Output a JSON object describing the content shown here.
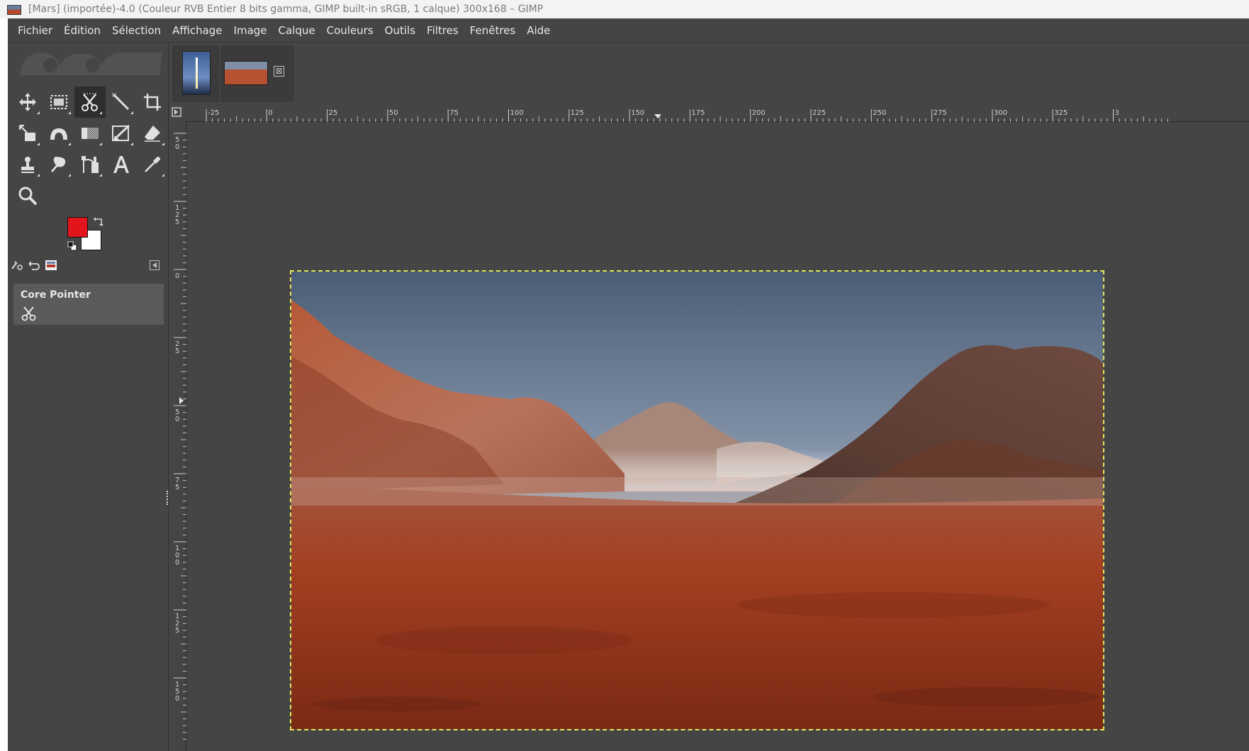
{
  "window": {
    "title": "[Mars] (importée)-4.0 (Couleur RVB Entier 8 bits gamma, GIMP built-in sRGB, 1 calque) 300x168 – GIMP"
  },
  "menubar": {
    "items": [
      "Fichier",
      "Édition",
      "Sélection",
      "Affichage",
      "Image",
      "Calque",
      "Couleurs",
      "Outils",
      "Filtres",
      "Fenêtres",
      "Aide"
    ]
  },
  "toolbox": {
    "tools": [
      {
        "name": "move-tool-icon",
        "active": false
      },
      {
        "name": "rect-select-tool-icon",
        "active": false
      },
      {
        "name": "scissors-select-tool-icon",
        "active": true
      },
      {
        "name": "fuzzy-select-tool-icon",
        "active": false
      },
      {
        "name": "crop-tool-icon",
        "active": false
      },
      {
        "name": "transform-tool-icon",
        "active": false
      },
      {
        "name": "warp-tool-icon",
        "active": false
      },
      {
        "name": "gradient-tool-icon",
        "active": false
      },
      {
        "name": "paint-tool-icon",
        "active": false
      },
      {
        "name": "eraser-tool-icon",
        "active": false
      },
      {
        "name": "clone-tool-icon",
        "active": false
      },
      {
        "name": "smudge-tool-icon",
        "active": false
      },
      {
        "name": "paths-tool-icon",
        "active": false
      },
      {
        "name": "text-tool-icon",
        "active": false
      },
      {
        "name": "color-picker-tool-icon",
        "active": false
      },
      {
        "name": "zoom-tool-icon",
        "active": false
      }
    ],
    "foreground_color": "#e3141b",
    "background_color": "#ffffff"
  },
  "device_status": {
    "title": "Core Pointer"
  },
  "image_tabs": {
    "close_glyph": "⊠"
  },
  "rulers": {
    "horizontal_labels": [
      "-25",
      "0",
      "25",
      "50",
      "75",
      "100",
      "125",
      "150",
      "175",
      "200",
      "225",
      "250",
      "275",
      "300",
      "325",
      "3"
    ],
    "vertical_labels": [
      "5|0",
      "1|2|5",
      "0",
      "2|5",
      "5|0",
      "7|5",
      "1|0|0",
      "1|2|5",
      "1|5|0"
    ]
  }
}
